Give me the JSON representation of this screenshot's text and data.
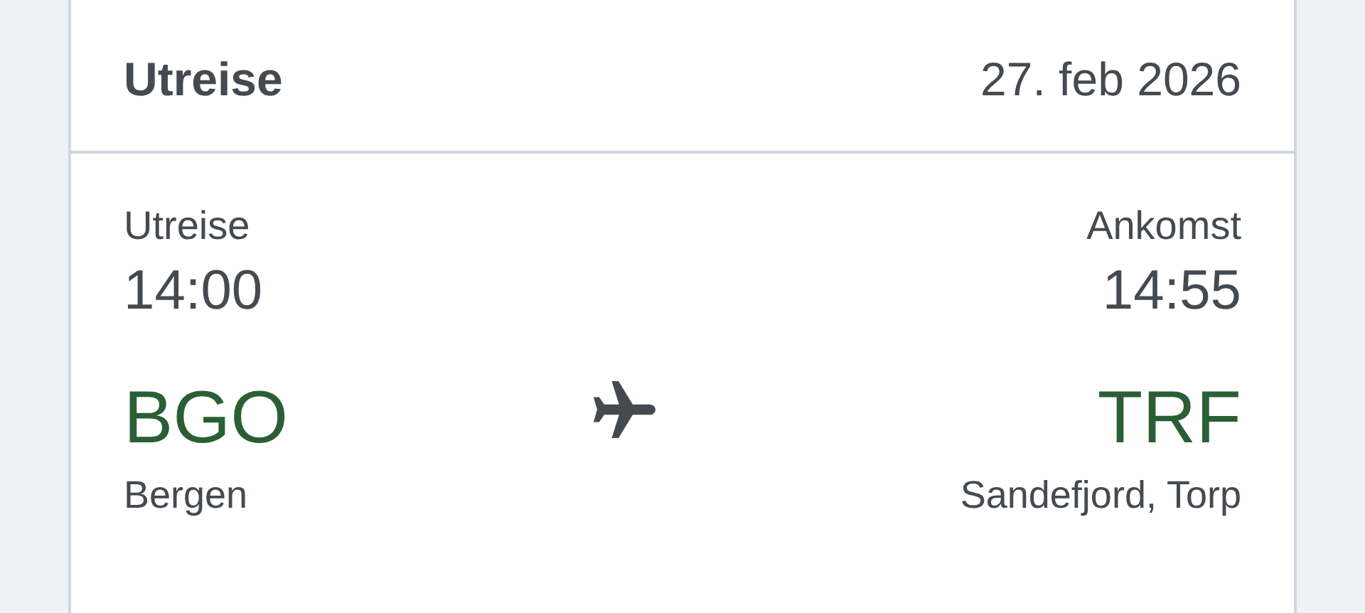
{
  "header": {
    "title": "Utreise",
    "date": "27. feb 2026"
  },
  "departure": {
    "label": "Utreise",
    "time": "14:00",
    "code": "BGO",
    "city": "Bergen"
  },
  "arrival": {
    "label": "Ankomst",
    "time": "14:55",
    "code": "TRF",
    "city": "Sandefjord, Torp"
  }
}
